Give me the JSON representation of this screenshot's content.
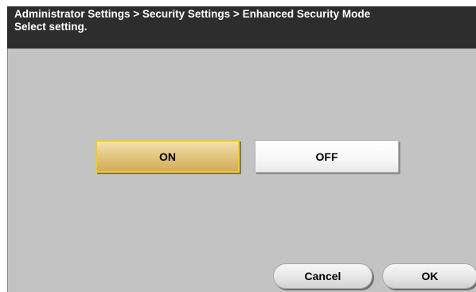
{
  "header": {
    "breadcrumb": "Administrator Settings > Security Settings > Enhanced Security Mode",
    "instruction": "Select setting."
  },
  "options": {
    "on_label": "ON",
    "off_label": "OFF",
    "selected": "ON"
  },
  "footer": {
    "cancel_label": "Cancel",
    "ok_label": "OK"
  },
  "colors": {
    "header_bg": "#2d2d2d",
    "content_bg": "#c3c3c3",
    "selected_border": "#f0cc1e",
    "selected_fill": "#e0c27a"
  }
}
